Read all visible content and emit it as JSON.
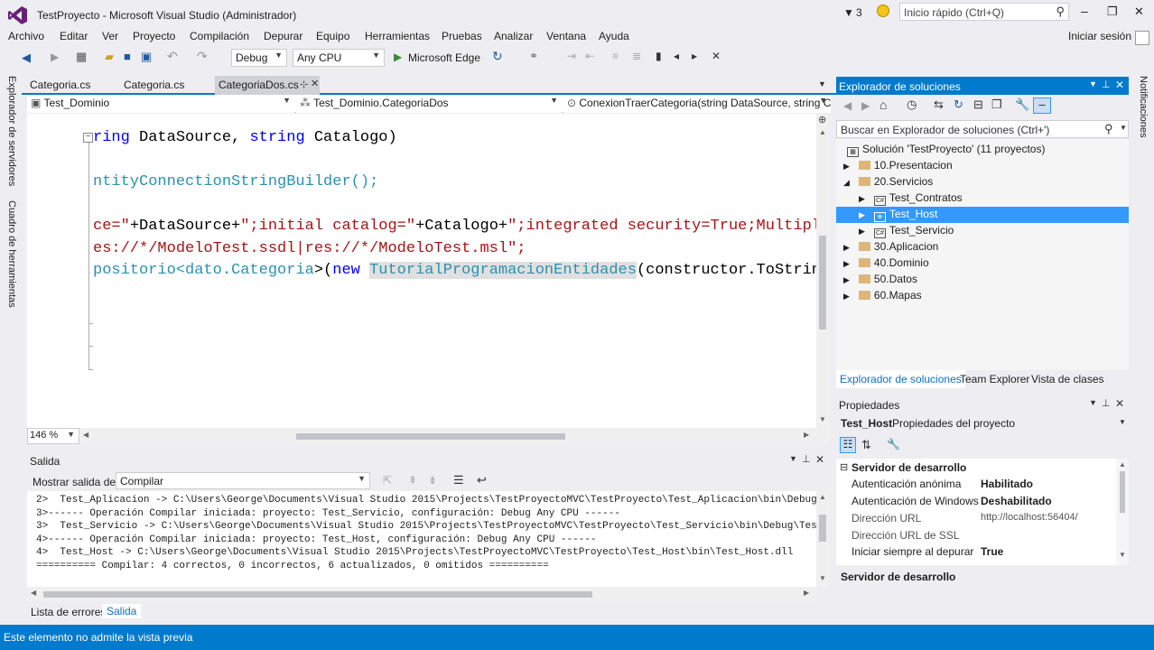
{
  "title": {
    "text": "TestProyecto - Microsoft Visual Studio (Administrador)",
    "filter_count": "3",
    "quick_launch": "Inicio rápido (Ctrl+Q)",
    "min": "–",
    "max": "❐",
    "close": "✕"
  },
  "menu": [
    "Archivo",
    "Editar",
    "Ver",
    "Proyecto",
    "Compilación",
    "Depurar",
    "Equipo",
    "Herramientas",
    "Pruebas",
    "Analizar",
    "Ventana",
    "Ayuda"
  ],
  "signin": "Iniciar sesión",
  "toolbar": {
    "config": "Debug",
    "platform": "Any CPU",
    "run": "Microsoft Edge"
  },
  "side_left": [
    "Explorador de servidores",
    "Cuadro de herramientas"
  ],
  "side_right": "Notificaciones",
  "tabs": [
    "Categoria.cs",
    "Categoria.cs",
    "CategoriaDos.cs"
  ],
  "nav": {
    "project": "Test_Dominio",
    "class": "Test_Dominio.CategoriaDos",
    "member": "ConexionTraerCategoria(string DataSource, string Ca"
  },
  "zoom": "146 %",
  "code": {
    "l1a": "ring",
    "l1b": " DataSource, ",
    "l1c": "string",
    "l1d": " Catalogo)",
    "l2": "ntityConnectionStringBuilder();",
    "l3a": "ce=\"",
    "l3b": "+DataSource+",
    "l3c": "\";initial catalog=\"",
    "l3d": "+Catalogo+",
    "l3e": "\";integrated security=True;MultipleAc",
    "l4": "es://*/ModeloTest.ssdl|res://*/ModeloTest.msl\";",
    "l5a": "positorio<dato.",
    "l5b": "Categoria",
    "l5c": ">(",
    "l5d": "new",
    "l5e": " ",
    "l5f": "TutorialProgramacionEntidades",
    "l5g": "(constructor.ToString(",
    ")": ")"
  },
  "output": {
    "title": "Salida",
    "show_label": "Mostrar salida de:",
    "show_value": "Compilar",
    "lines": [
      "2>  Test_Aplicacion -> C:\\Users\\George\\Documents\\Visual Studio 2015\\Projects\\TestProyectoMVC\\TestProyecto\\Test_Aplicacion\\bin\\Debug\\",
      "3>------ Operación Compilar iniciada: proyecto: Test_Servicio, configuración: Debug Any CPU ------",
      "3>  Test_Servicio -> C:\\Users\\George\\Documents\\Visual Studio 2015\\Projects\\TestProyectoMVC\\TestProyecto\\Test_Servicio\\bin\\Debug\\Tes",
      "4>------ Operación Compilar iniciada: proyecto: Test_Host, configuración: Debug Any CPU ------",
      "4>  Test_Host -> C:\\Users\\George\\Documents\\Visual Studio 2015\\Projects\\TestProyectoMVC\\TestProyecto\\Test_Host\\bin\\Test_Host.dll",
      "========== Compilar: 4 correctos, 0 incorrectos, 6 actualizados, 0 omitidos =========="
    ],
    "tabs": [
      "Lista de errores",
      "Salida"
    ]
  },
  "solution": {
    "title": "Explorador de soluciones",
    "search": "Buscar en Explorador de soluciones (Ctrl+')",
    "root": "Solución 'TestProyecto' (11 proyectos)",
    "items": [
      "10.Presentacion",
      "20.Servicios",
      "Test_Contratos",
      "Test_Host",
      "Test_Servicio",
      "30.Aplicacion",
      "40.Dominio",
      "50.Datos",
      "60.Mapas"
    ],
    "tabs": [
      "Explorador de soluciones",
      "Team Explorer",
      "Vista de clases"
    ]
  },
  "props": {
    "title": "Propiedades",
    "object": "Test_Host",
    "object_type": "Propiedades del proyecto",
    "section": "Servidor de desarrollo",
    "rows": [
      {
        "k": "Autenticación anónima",
        "v": "Habilitado"
      },
      {
        "k": "Autenticación de Windows",
        "v": "Deshabilitado"
      },
      {
        "k": "Dirección URL",
        "v": "http://localhost:56404/"
      },
      {
        "k": "Dirección URL de SSL",
        "v": ""
      },
      {
        "k": "Iniciar siempre al depurar",
        "v": "True"
      }
    ],
    "desc": "Servidor de desarrollo"
  },
  "status": "Este elemento no admite la vista previa",
  "colors": {
    "accent": "#007acc",
    "select": "#3399ff",
    "vs_purple": "#68217a"
  }
}
